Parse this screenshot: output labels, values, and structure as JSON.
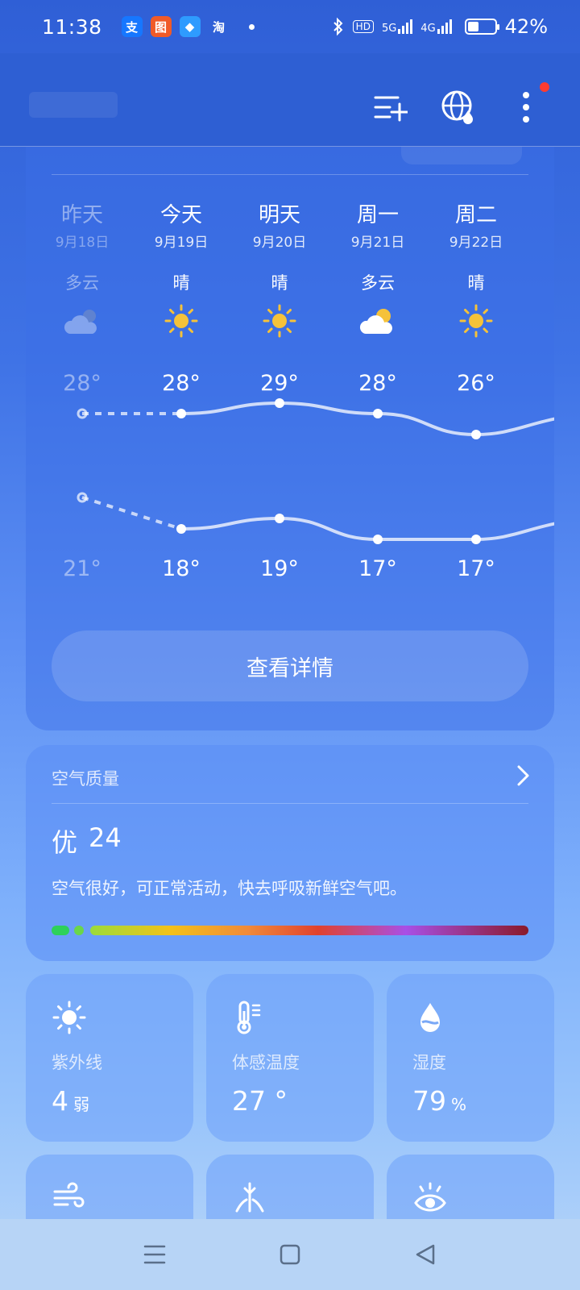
{
  "status_bar": {
    "time": "11:38",
    "apps": [
      {
        "glyph": "支",
        "color": "#1677ff",
        "name": "alipay-icon"
      },
      {
        "glyph": "图",
        "color": "#f05a28",
        "name": "taobao-map-icon"
      },
      {
        "glyph": "◆",
        "color": "#2e9bff",
        "name": "app-icon"
      },
      {
        "glyph": "淘",
        "color": "transparent",
        "name": "taobao-icon"
      }
    ],
    "hd_label": "HD",
    "net1": "5G",
    "net2": "4G",
    "battery_percent": "42%",
    "battery_level": 0.42
  },
  "header": {
    "actions": [
      "add-city",
      "global-weather",
      "more"
    ]
  },
  "forecast": {
    "days": [
      {
        "name": "昨天",
        "date": "9月18日",
        "cond": "多云",
        "icon": "cloud-night-icon",
        "high": "28°",
        "low": "21°",
        "past": true
      },
      {
        "name": "今天",
        "date": "9月19日",
        "cond": "晴",
        "icon": "sun-icon",
        "high": "28°",
        "low": "18°"
      },
      {
        "name": "明天",
        "date": "9月20日",
        "cond": "晴",
        "icon": "sun-icon",
        "high": "29°",
        "low": "19°"
      },
      {
        "name": "周一",
        "date": "9月21日",
        "cond": "多云",
        "icon": "partly-cloudy-icon",
        "high": "28°",
        "low": "17°"
      },
      {
        "name": "周二",
        "date": "9月22日",
        "cond": "晴",
        "icon": "sun-icon",
        "high": "26°",
        "low": "17°"
      }
    ],
    "high_values": [
      28,
      28,
      29,
      28,
      26
    ],
    "low_values": [
      21,
      18,
      19,
      17,
      17
    ],
    "detail_button": "查看详情"
  },
  "air_quality": {
    "title": "空气质量",
    "level": "优",
    "index": "24",
    "description": "空气很好，可正常活动，快去呼吸新鲜空气吧。"
  },
  "details": [
    {
      "label": "紫外线",
      "value": "4",
      "unit": "弱",
      "icon": "uv-sun-icon"
    },
    {
      "label": "体感温度",
      "value": "27 °",
      "unit": "",
      "icon": "thermometer-icon"
    },
    {
      "label": "湿度",
      "value": "79",
      "unit": "%",
      "icon": "humidity-drop-icon"
    }
  ],
  "details_row2": [
    {
      "icon": "wind-icon"
    },
    {
      "icon": "pressure-icon"
    },
    {
      "icon": "visibility-eye-icon"
    }
  ],
  "colors": {
    "sun": "#f5c23a",
    "red_dot": "#ff3b30",
    "aqi_good": "#2ed15a"
  }
}
